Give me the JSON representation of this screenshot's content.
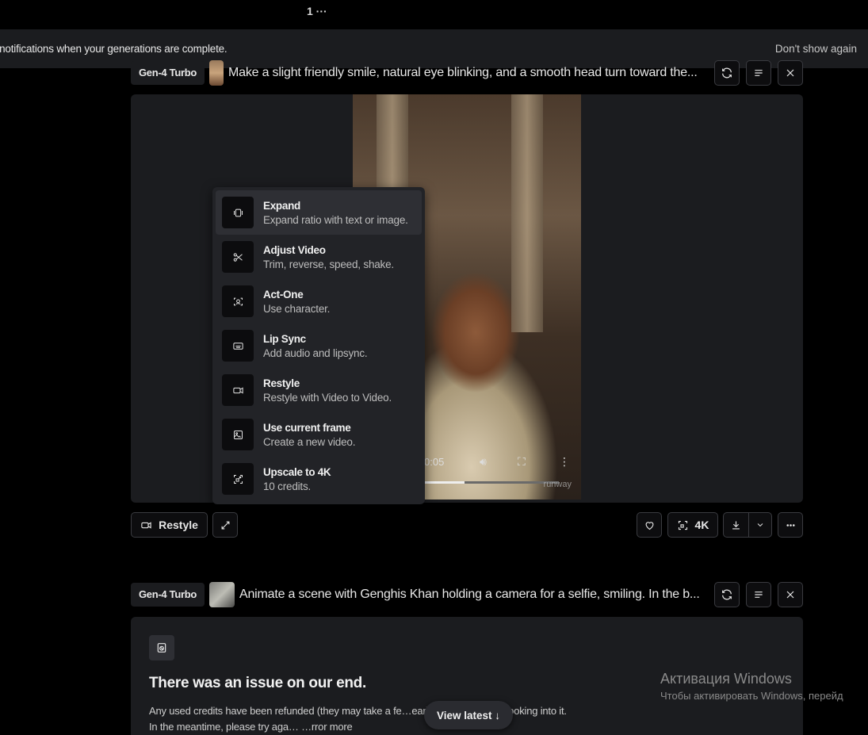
{
  "top": {
    "count": "1 ···"
  },
  "notification": {
    "message": "t notifications when your generations are complete.",
    "dismiss": "Don't show again"
  },
  "gen1": {
    "model": "Gen-4 Turbo",
    "prompt": "Make a slight friendly smile, natural eye blinking, and a smooth head turn toward the...",
    "video": {
      "time": "0:05",
      "watermark": "runway"
    }
  },
  "menu": {
    "items": [
      {
        "title": "Expand",
        "sub": "Expand ratio with text or image."
      },
      {
        "title": "Adjust Video",
        "sub": "Trim, reverse, speed, shake."
      },
      {
        "title": "Act-One",
        "sub": "Use character."
      },
      {
        "title": "Lip Sync",
        "sub": "Add audio and lipsync."
      },
      {
        "title": "Restyle",
        "sub": "Restyle with Video to Video."
      },
      {
        "title": "Use current frame",
        "sub": "Create a new video."
      },
      {
        "title": "Upscale to 4K",
        "sub": "10 credits."
      }
    ]
  },
  "actions": {
    "restyle": "Restyle",
    "upscale": "4K"
  },
  "gen2": {
    "model": "Gen-4 Turbo",
    "prompt": "Animate a scene with Genghis Khan holding a camera for a selfie, smiling. In the b...",
    "error_title": "There was an issue on our end.",
    "error_body": "Any used credits have been refunded (they may take a fe…ear), and our team is looking into it. In the meantime, please try aga… …rror more"
  },
  "view_latest": "View latest ↓",
  "windows": {
    "title": "Активация Windows",
    "sub": "Чтобы активировать Windows, перейд"
  }
}
